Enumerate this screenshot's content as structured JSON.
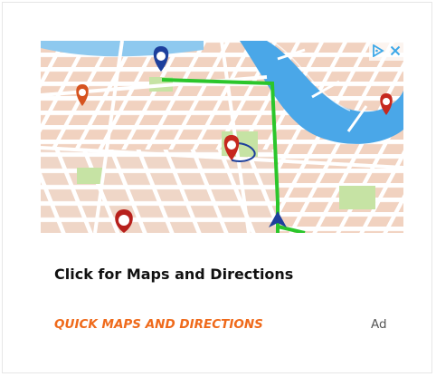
{
  "ad": {
    "headline": "Click for Maps and Directions",
    "advertiser": "QUICK MAPS AND DIRECTIONS",
    "label": "Ad",
    "image_subject": "city-map-with-location-pins-and-route",
    "adchoices_icon": "adchoices-triangle-icon",
    "close_icon": "close-x-icon"
  },
  "colors": {
    "advertiser_text": "#ef6a1b",
    "adchoices": "#3da8e8",
    "route": "#2bc62b",
    "water": "#4aa7e8",
    "pin_red": "#c6281e",
    "pin_blue": "#1d3f9c"
  }
}
